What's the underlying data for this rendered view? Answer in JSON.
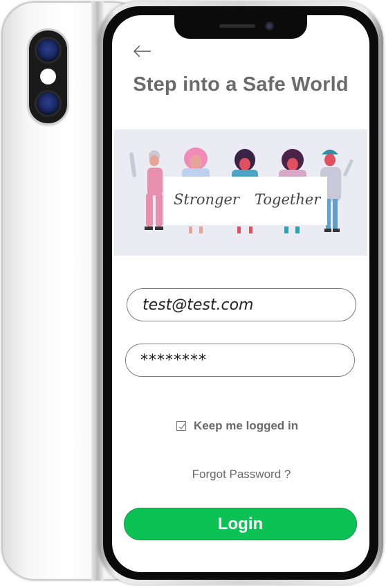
{
  "screen": {
    "title": "Step into a Safe World",
    "banner": {
      "text_left": "Stronger",
      "text_right": "Together"
    },
    "email_value": "test@test.com",
    "password_value": "********",
    "remember_label": "Keep me logged in",
    "remember_checked": true,
    "forgot_label": "Forgot Password ?",
    "login_label": "Login"
  },
  "colors": {
    "accent": "#0dc254",
    "title": "#6b6b6b",
    "banner_bg": "#ebebf3"
  },
  "icons": {
    "back": "back-arrow-icon",
    "check": "checkmark-icon"
  }
}
